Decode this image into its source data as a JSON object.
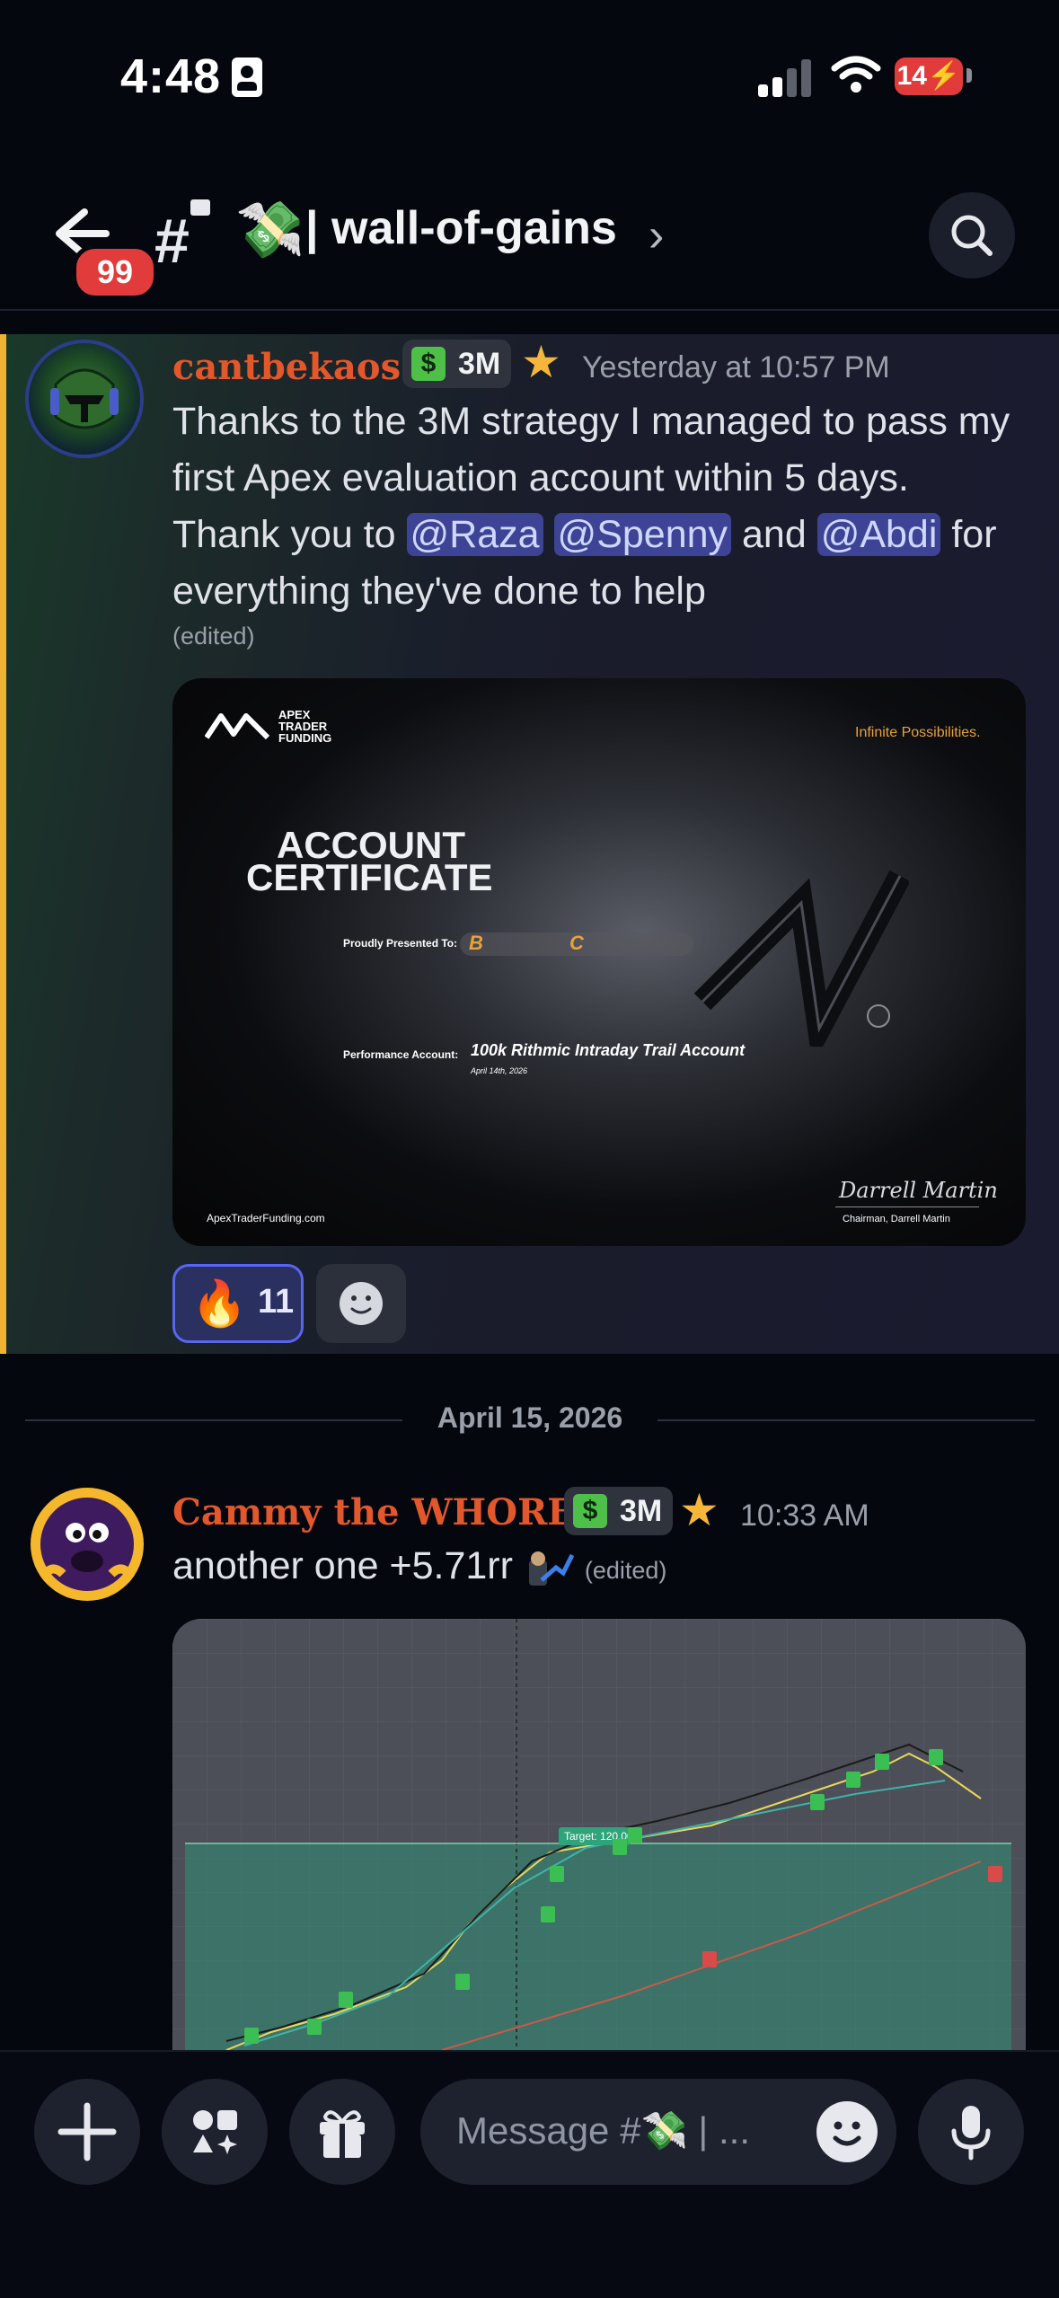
{
  "status_bar": {
    "time": "4:48",
    "battery": "14"
  },
  "header": {
    "unread_count": "99",
    "hash": "#",
    "channel_emoji": "💸",
    "channel_name": "| wall-of-gains",
    "chevron": "›"
  },
  "message1": {
    "username": "cantbekaos",
    "username_color": "#e2572b",
    "role": "3M",
    "timestamp": "Yesterday at 10:57 PM",
    "text_part1": "Thanks to the 3M strategy I managed to pass my first  Apex evaluation account within 5 days. Thank you to ",
    "mention1": "@Raza",
    "mention2": "@Spenny",
    "text_and": " and ",
    "mention3": "@Abdi",
    "text_part2": " for everything they've done to help",
    "edited": "(edited)",
    "certificate": {
      "brand_line1": "APEX",
      "brand_line2": "TRADER",
      "brand_line3": "FUNDING",
      "tagline": "Infinite Possibilities.",
      "title_line1": "ACCOUNT",
      "title_line2": "CERTIFICATE",
      "presented_label": "Proudly Presented To:",
      "initial1": "B",
      "initial2": "C",
      "performance_label": "Performance Account:",
      "account_name": "100k Rithmic Intraday Trail Account",
      "date": "April 14th, 2026",
      "website": "ApexTraderFunding.com",
      "signature": "Darrell Martin",
      "signer": "Chairman, Darrell Martin"
    },
    "reaction": {
      "emoji": "🔥",
      "count": "11"
    }
  },
  "date_divider": "April 15, 2026",
  "message2": {
    "username": "Cammy the WHORE",
    "username_color": "#e2572b",
    "role": "3M",
    "timestamp": "10:33 AM",
    "text": "another one +5.71rr",
    "edited": "(edited)",
    "chart": {
      "target_label": "Target: 120.00"
    }
  },
  "composer": {
    "placeholder": "Message #💸 | ..."
  },
  "icons": [
    "back-arrow-icon",
    "lock-icon",
    "search-icon",
    "role-icon",
    "star-icon",
    "smile-icon",
    "plus-icon",
    "apps-icon",
    "gift-icon",
    "mic-icon"
  ]
}
